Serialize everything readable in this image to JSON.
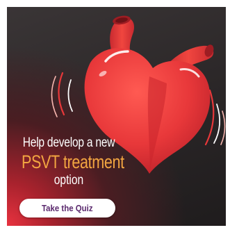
{
  "ad": {
    "headline_line1": "Help develop a new",
    "headline_line2": "PSVT treatment",
    "headline_line3": "option",
    "cta_label": "Take the Quiz",
    "icon": "beating-heart-illustration"
  },
  "colors": {
    "accent_orange": "#f2a541",
    "heart_red": "#e8383a",
    "button_text_purple": "#5b2a6e",
    "background_dark": "#2a2627"
  }
}
